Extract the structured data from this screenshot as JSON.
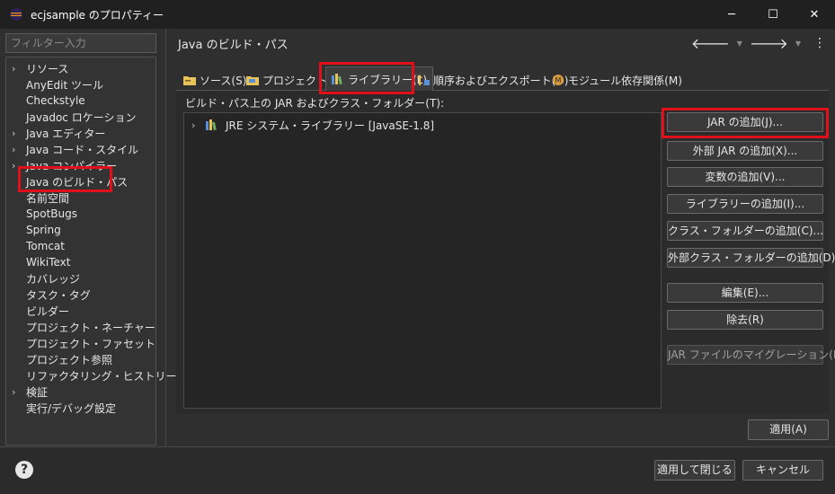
{
  "window": {
    "title": "ecjsample のプロパティー",
    "minimize": "─",
    "maximize": "☐",
    "close": "✕"
  },
  "sidebar": {
    "filter_placeholder": "フィルター入力",
    "items": [
      {
        "label": "リソース",
        "arrow": true
      },
      {
        "label": "AnyEdit ツール",
        "arrow": false
      },
      {
        "label": "Checkstyle",
        "arrow": false
      },
      {
        "label": "Javadoc ロケーション",
        "arrow": false
      },
      {
        "label": "Java エディター",
        "arrow": true
      },
      {
        "label": "Java コード・スタイル",
        "arrow": true
      },
      {
        "label": "Java コンパイラー",
        "arrow": true
      },
      {
        "label": "Java のビルド・パス",
        "arrow": false,
        "selected": true
      },
      {
        "label": "名前空間",
        "arrow": false
      },
      {
        "label": "SpotBugs",
        "arrow": false
      },
      {
        "label": "Spring",
        "arrow": false
      },
      {
        "label": "Tomcat",
        "arrow": false
      },
      {
        "label": "WikiText",
        "arrow": false
      },
      {
        "label": "カバレッジ",
        "arrow": false
      },
      {
        "label": "タスク・タグ",
        "arrow": false
      },
      {
        "label": "ビルダー",
        "arrow": false
      },
      {
        "label": "プロジェクト・ネーチャー",
        "arrow": false
      },
      {
        "label": "プロジェクト・ファセット",
        "arrow": false
      },
      {
        "label": "プロジェクト参照",
        "arrow": false
      },
      {
        "label": "リファクタリング・ヒストリー",
        "arrow": false
      },
      {
        "label": "検証",
        "arrow": true
      },
      {
        "label": "実行/デバッグ設定",
        "arrow": false
      }
    ]
  },
  "main": {
    "title": "Java のビルド・パス",
    "nav": {
      "back": "🡐",
      "forward": "🡒",
      "dropdown": "▼",
      "menu": "⋮"
    },
    "tabs": [
      {
        "label": "ソース(S)",
        "icon": "folder-source-icon"
      },
      {
        "label": "プロジェクト(P",
        "icon": "folder-project-icon"
      },
      {
        "label": "ライブラリー(L)",
        "icon": "library-icon",
        "active": true
      },
      {
        "label": "順序およびエクスポート(O)",
        "icon": "order-export-icon"
      },
      {
        "label": "モジュール依存関係(M)",
        "icon": "module-icon"
      }
    ],
    "panel_label": "ビルド・パス上の JAR およびクラス・フォルダー(T):",
    "tree_items": [
      {
        "label": "JRE システム・ライブラリー [JavaSE-1.8]",
        "icon": "library-icon"
      }
    ],
    "buttons": [
      {
        "label": "JAR の追加(J)..."
      },
      {
        "label": "外部 JAR の追加(X)..."
      },
      {
        "label": "変数の追加(V)..."
      },
      {
        "label": "ライブラリーの追加(I)..."
      },
      {
        "label": "クラス・フォルダーの追加(C)..."
      },
      {
        "label": "外部クラス・フォルダーの追加(D)..."
      },
      {
        "label": "編集(E)..."
      },
      {
        "label": "除去(R)"
      },
      {
        "label": "JAR ファイルのマイグレーション(M)...",
        "disabled": true
      }
    ],
    "apply": "適用(A)"
  },
  "footer": {
    "help": "?",
    "apply_close": "適用して閉じる",
    "cancel": "キャンセル"
  },
  "colors": {
    "highlight": "#e0101a",
    "background": "#2f2f2f",
    "titlebar": "#202020"
  }
}
